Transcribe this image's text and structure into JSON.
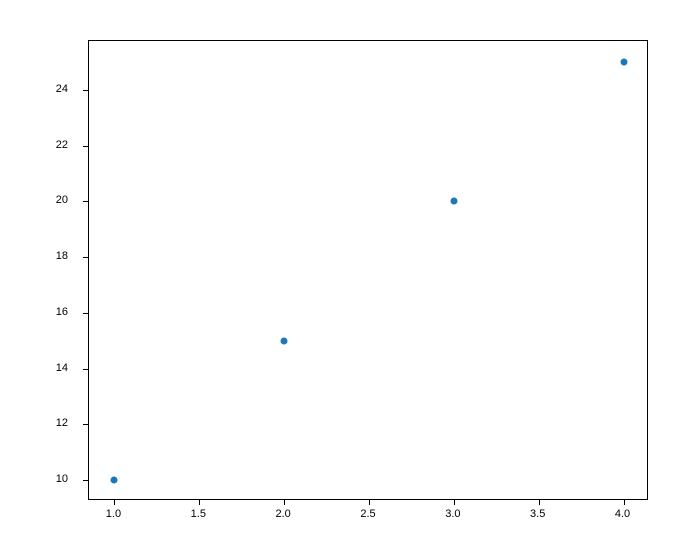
{
  "chart_data": {
    "type": "scatter",
    "x": [
      1,
      2,
      3,
      4
    ],
    "y": [
      10,
      15,
      20,
      25
    ],
    "title": "",
    "xlabel": "",
    "ylabel": "",
    "xlim": [
      0.85,
      4.15
    ],
    "ylim": [
      9.25,
      25.75
    ],
    "x_ticks": [
      1.0,
      1.5,
      2.0,
      2.5,
      3.0,
      3.5,
      4.0
    ],
    "y_ticks": [
      10,
      12,
      14,
      16,
      18,
      20,
      22,
      24
    ],
    "x_tick_labels": [
      "1.0",
      "1.5",
      "2.0",
      "2.5",
      "3.0",
      "3.5",
      "4.0"
    ],
    "y_tick_labels": [
      "10",
      "12",
      "14",
      "16",
      "18",
      "20",
      "22",
      "24"
    ],
    "point_color": "#1f77b4"
  }
}
